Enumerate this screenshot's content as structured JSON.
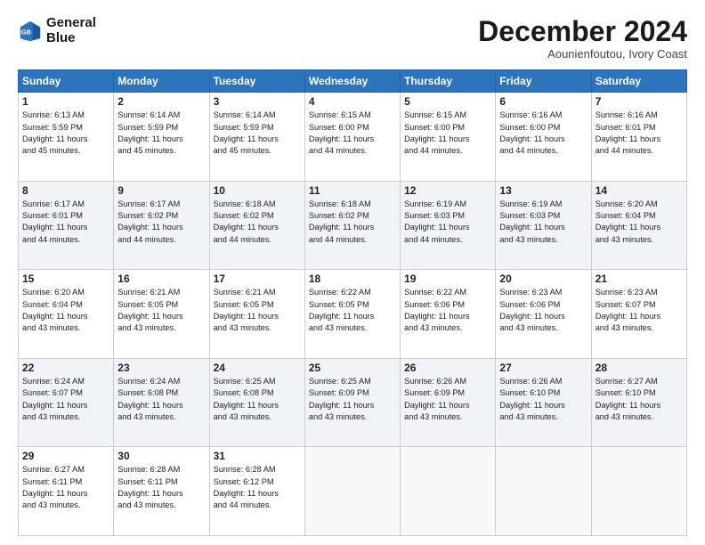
{
  "header": {
    "logo_line1": "General",
    "logo_line2": "Blue",
    "month": "December 2024",
    "location": "Aounienfoutou, Ivory Coast"
  },
  "days_of_week": [
    "Sunday",
    "Monday",
    "Tuesday",
    "Wednesday",
    "Thursday",
    "Friday",
    "Saturday"
  ],
  "weeks": [
    [
      {
        "day": "1",
        "info": "Sunrise: 6:13 AM\nSunset: 5:59 PM\nDaylight: 11 hours\nand 45 minutes."
      },
      {
        "day": "2",
        "info": "Sunrise: 6:14 AM\nSunset: 5:59 PM\nDaylight: 11 hours\nand 45 minutes."
      },
      {
        "day": "3",
        "info": "Sunrise: 6:14 AM\nSunset: 5:59 PM\nDaylight: 11 hours\nand 45 minutes."
      },
      {
        "day": "4",
        "info": "Sunrise: 6:15 AM\nSunset: 6:00 PM\nDaylight: 11 hours\nand 44 minutes."
      },
      {
        "day": "5",
        "info": "Sunrise: 6:15 AM\nSunset: 6:00 PM\nDaylight: 11 hours\nand 44 minutes."
      },
      {
        "day": "6",
        "info": "Sunrise: 6:16 AM\nSunset: 6:00 PM\nDaylight: 11 hours\nand 44 minutes."
      },
      {
        "day": "7",
        "info": "Sunrise: 6:16 AM\nSunset: 6:01 PM\nDaylight: 11 hours\nand 44 minutes."
      }
    ],
    [
      {
        "day": "8",
        "info": "Sunrise: 6:17 AM\nSunset: 6:01 PM\nDaylight: 11 hours\nand 44 minutes."
      },
      {
        "day": "9",
        "info": "Sunrise: 6:17 AM\nSunset: 6:02 PM\nDaylight: 11 hours\nand 44 minutes."
      },
      {
        "day": "10",
        "info": "Sunrise: 6:18 AM\nSunset: 6:02 PM\nDaylight: 11 hours\nand 44 minutes."
      },
      {
        "day": "11",
        "info": "Sunrise: 6:18 AM\nSunset: 6:02 PM\nDaylight: 11 hours\nand 44 minutes."
      },
      {
        "day": "12",
        "info": "Sunrise: 6:19 AM\nSunset: 6:03 PM\nDaylight: 11 hours\nand 44 minutes."
      },
      {
        "day": "13",
        "info": "Sunrise: 6:19 AM\nSunset: 6:03 PM\nDaylight: 11 hours\nand 43 minutes."
      },
      {
        "day": "14",
        "info": "Sunrise: 6:20 AM\nSunset: 6:04 PM\nDaylight: 11 hours\nand 43 minutes."
      }
    ],
    [
      {
        "day": "15",
        "info": "Sunrise: 6:20 AM\nSunset: 6:04 PM\nDaylight: 11 hours\nand 43 minutes."
      },
      {
        "day": "16",
        "info": "Sunrise: 6:21 AM\nSunset: 6:05 PM\nDaylight: 11 hours\nand 43 minutes."
      },
      {
        "day": "17",
        "info": "Sunrise: 6:21 AM\nSunset: 6:05 PM\nDaylight: 11 hours\nand 43 minutes."
      },
      {
        "day": "18",
        "info": "Sunrise: 6:22 AM\nSunset: 6:05 PM\nDaylight: 11 hours\nand 43 minutes."
      },
      {
        "day": "19",
        "info": "Sunrise: 6:22 AM\nSunset: 6:06 PM\nDaylight: 11 hours\nand 43 minutes."
      },
      {
        "day": "20",
        "info": "Sunrise: 6:23 AM\nSunset: 6:06 PM\nDaylight: 11 hours\nand 43 minutes."
      },
      {
        "day": "21",
        "info": "Sunrise: 6:23 AM\nSunset: 6:07 PM\nDaylight: 11 hours\nand 43 minutes."
      }
    ],
    [
      {
        "day": "22",
        "info": "Sunrise: 6:24 AM\nSunset: 6:07 PM\nDaylight: 11 hours\nand 43 minutes."
      },
      {
        "day": "23",
        "info": "Sunrise: 6:24 AM\nSunset: 6:08 PM\nDaylight: 11 hours\nand 43 minutes."
      },
      {
        "day": "24",
        "info": "Sunrise: 6:25 AM\nSunset: 6:08 PM\nDaylight: 11 hours\nand 43 minutes."
      },
      {
        "day": "25",
        "info": "Sunrise: 6:25 AM\nSunset: 6:09 PM\nDaylight: 11 hours\nand 43 minutes."
      },
      {
        "day": "26",
        "info": "Sunrise: 6:26 AM\nSunset: 6:09 PM\nDaylight: 11 hours\nand 43 minutes."
      },
      {
        "day": "27",
        "info": "Sunrise: 6:26 AM\nSunset: 6:10 PM\nDaylight: 11 hours\nand 43 minutes."
      },
      {
        "day": "28",
        "info": "Sunrise: 6:27 AM\nSunset: 6:10 PM\nDaylight: 11 hours\nand 43 minutes."
      }
    ],
    [
      {
        "day": "29",
        "info": "Sunrise: 6:27 AM\nSunset: 6:11 PM\nDaylight: 11 hours\nand 43 minutes."
      },
      {
        "day": "30",
        "info": "Sunrise: 6:28 AM\nSunset: 6:11 PM\nDaylight: 11 hours\nand 43 minutes."
      },
      {
        "day": "31",
        "info": "Sunrise: 6:28 AM\nSunset: 6:12 PM\nDaylight: 11 hours\nand 44 minutes."
      },
      {
        "day": "",
        "info": ""
      },
      {
        "day": "",
        "info": ""
      },
      {
        "day": "",
        "info": ""
      },
      {
        "day": "",
        "info": ""
      }
    ]
  ]
}
